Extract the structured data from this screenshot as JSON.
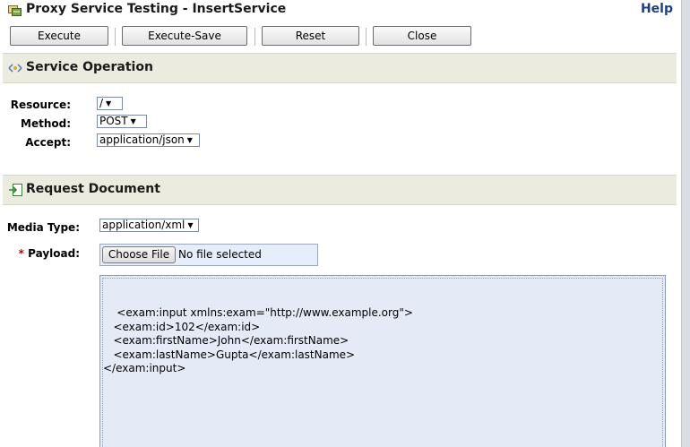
{
  "window": {
    "title": "Proxy Service Testing - InsertService",
    "help_label": "Help"
  },
  "toolbar": {
    "execute_label": "Execute",
    "execute_save_label": "Execute-Save",
    "reset_label": "Reset",
    "close_label": "Close"
  },
  "service_operation": {
    "title": "Service Operation",
    "resource_label": "Resource:",
    "resource_value": "/",
    "method_label": "Method:",
    "method_value": "POST",
    "accept_label": "Accept:",
    "accept_value": "application/json"
  },
  "request_document": {
    "title": "Request Document",
    "media_type_label": "Media Type:",
    "media_type_value": "application/xml",
    "payload_required_mark": "*",
    "payload_label": "Payload:",
    "choose_file_label": "Choose File",
    "no_file_text": "No file selected",
    "payload_text": "<exam:input xmlns:exam=\"http://www.example.org\">\n   <exam:id>102</exam:id>\n   <exam:firstName>John</exam:firstName>\n   <exam:lastName>Gupta</exam:lastName>\n</exam:input>"
  },
  "icons": {
    "title_icon": "proxy-service-icon",
    "service_icon": "service-operation-icon",
    "request_icon": "request-document-icon",
    "dropdown_arrow": "▼"
  },
  "colors": {
    "section_header_bg": "#ecebe0",
    "payload_bg": "#e4ebf7",
    "help_link": "#1f3f84",
    "required_mark": "#c00000"
  }
}
